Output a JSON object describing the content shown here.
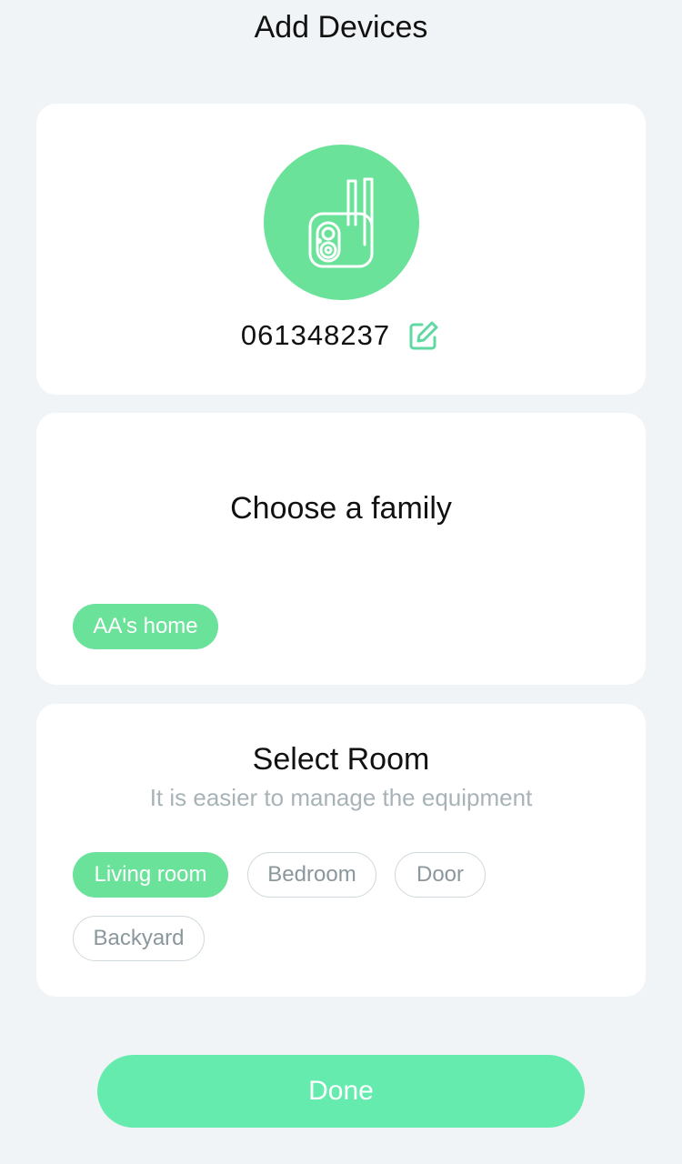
{
  "header": {
    "title": "Add Devices"
  },
  "device": {
    "icon": "camera-icon",
    "id": "061348237",
    "edit_icon": "edit-icon"
  },
  "family": {
    "title": "Choose a family",
    "options": [
      {
        "label": "AA's home",
        "selected": true
      }
    ]
  },
  "room": {
    "title": "Select Room",
    "subtitle": "It is easier to manage the equipment",
    "options": [
      {
        "label": "Living room",
        "selected": true
      },
      {
        "label": "Bedroom",
        "selected": false
      },
      {
        "label": "Door",
        "selected": false
      },
      {
        "label": "Backyard",
        "selected": false
      }
    ]
  },
  "footer": {
    "done_label": "Done"
  },
  "colors": {
    "accent": "#6be29a",
    "done_button": "#65ebae",
    "background": "#f1f4f6",
    "subtitle": "#a8b3b8"
  }
}
